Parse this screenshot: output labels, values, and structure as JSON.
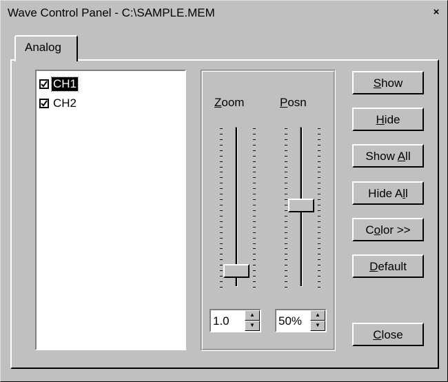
{
  "window": {
    "title": "Wave Control Panel - C:\\SAMPLE.MEM",
    "close_glyph": "×"
  },
  "tabs": [
    {
      "label": "Analog",
      "active": true
    }
  ],
  "channels": [
    {
      "label": "CH1",
      "checked": true,
      "selected": true
    },
    {
      "label": "CH2",
      "checked": true,
      "selected": false
    }
  ],
  "sliders": {
    "zoom": {
      "label": "Zoom",
      "mnemonic": "Z",
      "value": "1.0",
      "level": 0.95
    },
    "posn": {
      "label": "Posn",
      "mnemonic": "P",
      "value": "50%",
      "level": 0.5
    }
  },
  "buttons": {
    "show": "Show",
    "hide": "Hide",
    "show_all": "Show All",
    "hide_all": "Hide All",
    "color": "Color >>",
    "default": "Default",
    "close": "Close"
  },
  "icons": {
    "spin_up": "up-arrow-icon",
    "spin_down": "down-arrow-icon",
    "check": "check-icon"
  }
}
